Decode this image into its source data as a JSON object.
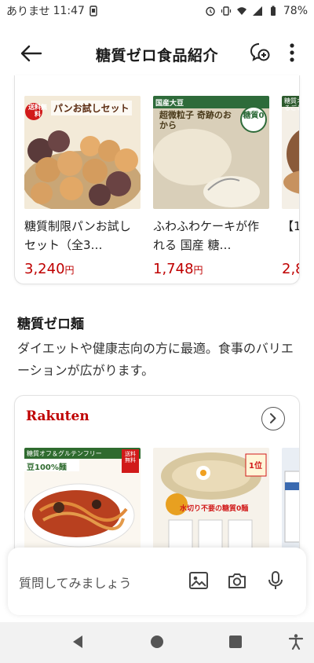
{
  "status_bar": {
    "notification_text": "ありませ",
    "time": "11:47",
    "battery": "78%"
  },
  "header": {
    "title": "糖質ゼロ食品紹介"
  },
  "card1": {
    "products": [
      {
        "badge": "送料無料",
        "image_caption": "パンお試しセット",
        "name": "糖質制限パンお試しセット（全3…",
        "price": "3,240",
        "currency": "円"
      },
      {
        "badge": "国産大豆",
        "image_caption": "超微粒子 奇跡のおから",
        "badge2": "糖質0",
        "name": "ふわふわケーキが作れる 国産 糖…",
        "price": "1,748",
        "currency": "円"
      },
      {
        "image_caption": "糖質オフ&グ まるごと",
        "name": "【15%ン】",
        "price": "2,88",
        "currency": ""
      }
    ]
  },
  "section": {
    "title": "糖質ゼロ麺",
    "description": "ダイエットや健康志向の方に最適。食事のバリエーションが広がります。"
  },
  "card2": {
    "logo": "Rakuten",
    "products": [
      {
        "banner": "糖質オフ＆グルテンフリー",
        "subtitle": "豆100%麺",
        "badge": "送料無料"
      },
      {
        "caption": "水切り不要の糖質0麺",
        "badge": "1位"
      },
      {}
    ]
  },
  "input": {
    "placeholder": "質問してみましょう"
  },
  "colors": {
    "price_red": "#bf0000",
    "brand_red": "#bf0000"
  }
}
